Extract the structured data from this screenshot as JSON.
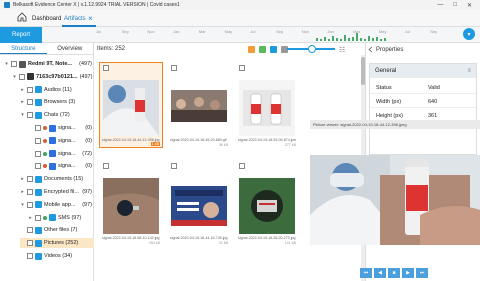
{
  "window": {
    "title": "Belkasoft Evidence Center X | v.1.12.9924 TRIAL VERSION | Covid cases1",
    "controls": [
      "—",
      "□",
      "✕"
    ]
  },
  "tabs": [
    {
      "label": "Dashboard",
      "active": false
    },
    {
      "label": "Artifacts",
      "active": true
    }
  ],
  "toolbar": {
    "report_label": "Report",
    "timeline_labels": [
      "Jul",
      "Sep",
      "Nov",
      "Jan",
      "Mar",
      "May",
      "Jul",
      "Sep",
      "Nov",
      "Jan",
      "Mar",
      "May",
      "Jul",
      "Sep"
    ]
  },
  "left_tabs": [
    {
      "label": "Structure",
      "active": true
    },
    {
      "label": "Overview",
      "active": false
    }
  ],
  "tree": [
    {
      "label": "Redmi 9T, Note...",
      "count": "(497)",
      "level": 0,
      "icon": "phone-icon",
      "arrow": "▾",
      "bold": true
    },
    {
      "label": "7163c97b0121...",
      "count": "(497)",
      "level": 1,
      "icon": "device-icon",
      "arrow": "▾",
      "bold": true
    },
    {
      "label": "Audios (11)",
      "count": "",
      "level": 2,
      "icon": "audio-icon",
      "arrow": "▸"
    },
    {
      "label": "Browsers (3)",
      "count": "",
      "level": 2,
      "icon": "browser-icon",
      "arrow": "▸"
    },
    {
      "label": "Chats (72)",
      "count": "",
      "level": 2,
      "icon": "chat-icon",
      "arrow": "▾"
    },
    {
      "label": "signa...",
      "count": "(0)",
      "level": 3,
      "icon": "signal-icon",
      "dot": "#e05a2b"
    },
    {
      "label": "signa...",
      "count": "(0)",
      "level": 3,
      "icon": "signal-icon",
      "dot": "#e05a2b"
    },
    {
      "label": "signa...",
      "count": "(72)",
      "level": 3,
      "icon": "signal-icon",
      "dot": "#3aa655"
    },
    {
      "label": "signa...",
      "count": "(0)",
      "level": 3,
      "icon": "signal-icon",
      "dot": "#e05a2b"
    },
    {
      "label": "Documents (15)",
      "count": "",
      "level": 2,
      "icon": "document-icon",
      "arrow": "▸"
    },
    {
      "label": "Encrypted fil...",
      "count": "(97)",
      "level": 2,
      "icon": "encrypted-icon",
      "arrow": "▸"
    },
    {
      "label": "Mobile app...",
      "count": "(97)",
      "level": 2,
      "icon": "mobile-app-icon",
      "arrow": "▾"
    },
    {
      "label": "SMS (97)",
      "count": "",
      "level": 3,
      "icon": "sms-icon",
      "arrow": "▸",
      "dot": "#3aa655"
    },
    {
      "label": "Other files (7)",
      "count": "",
      "level": 2,
      "icon": "file-icon",
      "arrow": ""
    },
    {
      "label": "Pictures (252)",
      "count": "",
      "level": 2,
      "icon": "pictures-icon",
      "arrow": "",
      "selected": true
    },
    {
      "label": "Videos (34)",
      "count": "",
      "level": 2,
      "icon": "video-icon",
      "arrow": ""
    }
  ],
  "gallery": {
    "items_label": "Items: 252",
    "thumbs": [
      {
        "caption": "signal-2022-04-19-18-44-12-396.jpg",
        "size": "1 kB",
        "selected": true,
        "theme": "vaccine"
      },
      {
        "caption": "signal-2022-04-19-18-45-29-680.gif",
        "size": "36 kB",
        "selected": false,
        "theme": "crowd"
      },
      {
        "caption": "signal-2022-04-19-18-53-09-674.jpeg",
        "size": "277 kB",
        "selected": false,
        "theme": "bottle"
      },
      {
        "caption": "signal-2022-04-19-18-58-10-142.jpg",
        "size": "254 kB",
        "selected": false,
        "theme": "arm"
      },
      {
        "caption": "signal-2022-04-19-18-44-19-745.jpg",
        "size": "32 kB",
        "selected": false,
        "theme": "news"
      },
      {
        "caption": "signal-2022-04-19-18-36-20-273.jpg",
        "size": "101 kB",
        "selected": false,
        "theme": "badge"
      }
    ]
  },
  "properties": {
    "title": "Properties",
    "group": "General",
    "rows": [
      {
        "key": "Status",
        "value": "Valid"
      },
      {
        "key": "Width (px)",
        "value": "640"
      },
      {
        "key": "Height (px)",
        "value": "361"
      }
    ]
  },
  "viewer": {
    "header": "Picture viewer: signal-2022-04-19-18-44-12-396.jpeg",
    "nav": [
      "⏮",
      "◀",
      "■",
      "▶",
      "⏭"
    ]
  }
}
